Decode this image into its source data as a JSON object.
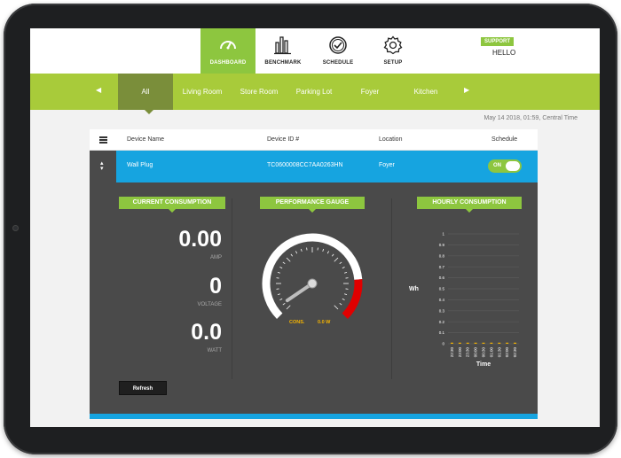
{
  "topnav": {
    "tabs": [
      {
        "label": "DASHBOARD",
        "icon": "speedometer-icon",
        "active": true
      },
      {
        "label": "BENCHMARK",
        "icon": "bar-chart-icon",
        "active": false
      },
      {
        "label": "SCHEDULE",
        "icon": "check-circle-icon",
        "active": false
      },
      {
        "label": "SETUP",
        "icon": "gear-icon",
        "active": false
      }
    ],
    "support_label": "SUPPORT",
    "greeting": "HELLO"
  },
  "rooms": {
    "prev_arrow": "◀",
    "next_arrow": "▶",
    "items": [
      "All",
      "Living Room",
      "Store Room",
      "Parking Lot",
      "Foyer",
      "Kitchen"
    ],
    "active": "All"
  },
  "timestamp": "May 14 2018, 01:59, Central Time",
  "table": {
    "columns": [
      "Device Name",
      "Device ID #",
      "Location",
      "Schedule"
    ],
    "row": {
      "device_name": "Wall Plug",
      "device_id": "TC0600008CC7AA0263HN",
      "location": "Foyer",
      "schedule_toggle": "ON",
      "schedule_on": true
    }
  },
  "current_consumption": {
    "title": "CURRENT CONSUMPTION",
    "amp_value": "0.00",
    "amp_label": "AMP",
    "voltage_value": "0",
    "voltage_label": "VOLTAGE",
    "watt_value": "0.0",
    "watt_label": "WATT",
    "refresh_label": "Refresh"
  },
  "performance_gauge": {
    "title": "PERFORMANCE GAUGE",
    "cons_label": "CONS.",
    "cons_value": "0.0 W",
    "needle_fraction": 0.0
  },
  "chart_data": {
    "type": "bar",
    "title": "HOURLY CONSUMPTION",
    "xlabel": "Time",
    "ylabel": "Wh",
    "ylim": [
      0,
      1
    ],
    "yticks": [
      "0",
      "0.1",
      "0.2",
      "0.3",
      "0.4",
      "0.5",
      "0.6",
      "0.7",
      "0.8",
      "0.9",
      "1"
    ],
    "categories": [
      "22:30",
      "23:00",
      "23:30",
      "00:00",
      "00:30",
      "01:00",
      "01:30",
      "02:00",
      "02:30"
    ],
    "values": [
      0,
      0,
      0,
      0,
      0,
      0,
      0,
      0,
      0
    ],
    "grid": true,
    "bar_color": "#f5b400"
  },
  "colors": {
    "brand_green": "#8dc63f",
    "row_blue": "#16a4e0",
    "panel_gray": "#4a4a4a",
    "gauge_red": "#e00000",
    "accent_yellow": "#f5b400"
  }
}
